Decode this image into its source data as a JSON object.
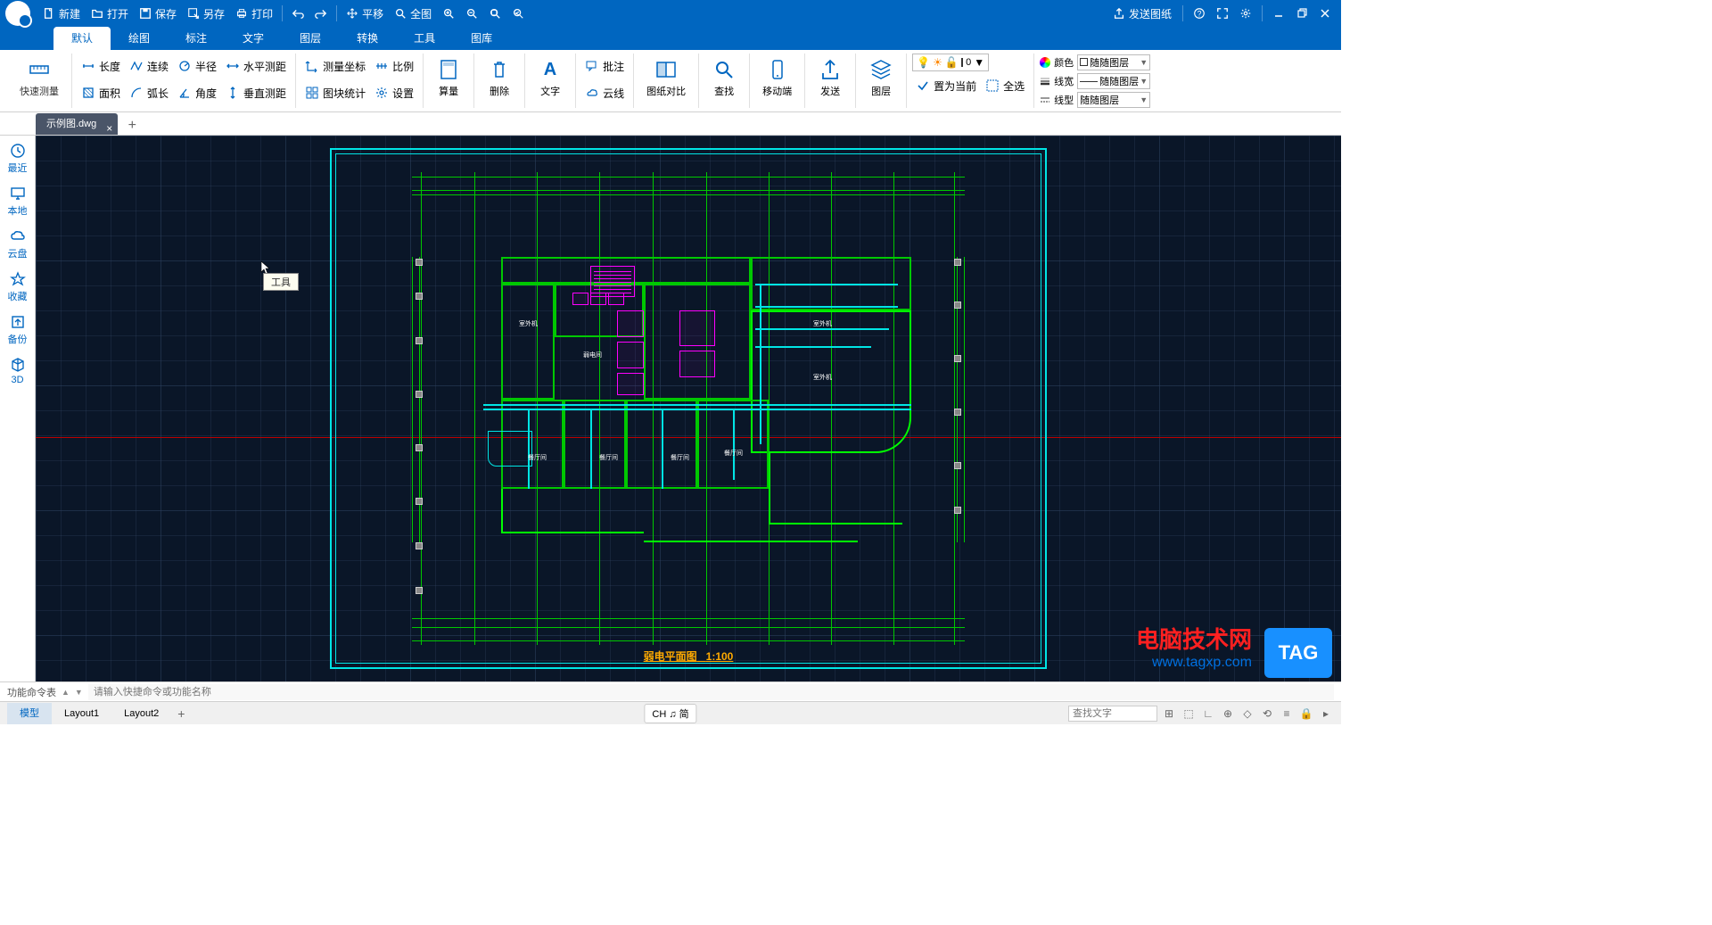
{
  "titlebar": {
    "new": "新建",
    "open": "打开",
    "save": "保存",
    "saveas": "另存",
    "print": "打印",
    "pan": "平移",
    "fullview": "全图",
    "send_drawing": "发送图纸"
  },
  "menu": {
    "tabs": [
      "默认",
      "绘图",
      "标注",
      "文字",
      "图层",
      "转换",
      "工具",
      "图库"
    ],
    "active": 0
  },
  "ribbon": {
    "quick_measure": "快速测量",
    "length": "长度",
    "continuous": "连续",
    "radius": "半径",
    "hdist": "水平测距",
    "area": "面积",
    "arc": "弧长",
    "angle": "角度",
    "vdist": "垂直测距",
    "coord": "测量坐标",
    "block_stat": "图块统计",
    "ratio": "比例",
    "settings": "设置",
    "calc": "算量",
    "delete": "删除",
    "text": "文字",
    "annotate": "批注",
    "cloud": "云线",
    "compare": "图纸对比",
    "find": "查找",
    "mobile": "移动端",
    "send": "发送",
    "layers": "图层",
    "set_current": "置为当前",
    "select_all": "全选",
    "layer_dropdown": "0",
    "prop_color_label": "颜色",
    "prop_color": "随随图层",
    "prop_lw_label": "线宽",
    "prop_lw": "随随图层",
    "prop_lt_label": "线型",
    "prop_lt": "随随图层"
  },
  "filetab": {
    "name": "示例图.dwg"
  },
  "tooltip": "工具",
  "sidebar": {
    "items": [
      {
        "icon": "clock",
        "label": "最近"
      },
      {
        "icon": "monitor",
        "label": "本地"
      },
      {
        "icon": "cloud",
        "label": "云盘"
      },
      {
        "icon": "star",
        "label": "收藏"
      },
      {
        "icon": "backup",
        "label": "备份"
      },
      {
        "icon": "cube",
        "label": "3D"
      }
    ]
  },
  "drawing": {
    "title": "弱电平面图",
    "scale": "1:100"
  },
  "cmdbar": {
    "label": "功能命令表",
    "placeholder": "请输入快捷命令或功能名称"
  },
  "statusbar": {
    "layouts": [
      "模型",
      "Layout1",
      "Layout2"
    ],
    "active_layout": 0,
    "ime": "CH ♫ 简",
    "search_placeholder": "查找文字"
  },
  "watermark": {
    "cn": "电脑技术网",
    "url": "www.tagxp.com",
    "tag": "TAG"
  }
}
